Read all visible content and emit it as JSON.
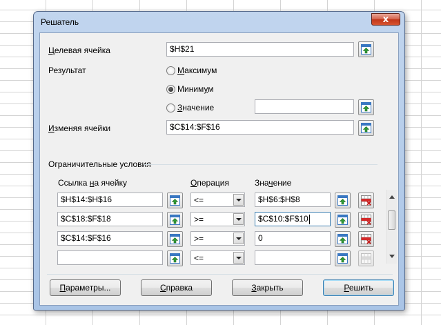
{
  "dialog": {
    "title": "Решатель",
    "close_glyph": "x",
    "target": {
      "label_ul": "Ц",
      "label_rest": "елевая ячейка",
      "value": "$H$21"
    },
    "result": {
      "label": "Результат",
      "options": [
        {
          "ul": "М",
          "rest": "аксимум",
          "checked": false
        },
        {
          "pre": "Миним",
          "ul": "у",
          "post": "м",
          "checked": true
        },
        {
          "ul": "З",
          "rest": "начение",
          "checked": false
        }
      ],
      "value_field": ""
    },
    "changing": {
      "label_ul": "И",
      "label_rest": "зменяя ячейки",
      "value": "$C$14:$F$16"
    },
    "constraints": {
      "group_label": "Ограничительные условия",
      "headers": {
        "cell_pre": "Ссылка ",
        "cell_ul": "н",
        "cell_post": "а ячейку",
        "op_ul": "О",
        "op_rest": "перация",
        "val_pre": "Зна",
        "val_ul": "ч",
        "val_post": "ение"
      },
      "rows": [
        {
          "cell": "$H$14:$H$16",
          "op": "<=",
          "value": "$H$6:$H$8"
        },
        {
          "cell": "$C$18:$F$18",
          "op": ">=",
          "value": "$C$10:$F$10"
        },
        {
          "cell": "$C$14:$F$16",
          "op": ">=",
          "value": "0"
        },
        {
          "cell": "",
          "op": "<=",
          "value": ""
        }
      ]
    },
    "buttons": {
      "params_ul": "П",
      "params_rest": "араметры...",
      "help_ul": "С",
      "help_rest": "правка",
      "close_ul": "З",
      "close_rest": "акрыть",
      "solve_ul": "Р",
      "solve_rest": "ешить"
    }
  },
  "icons": {
    "shrink": "shrink-icon",
    "remove": "remove-constraint-icon"
  },
  "colors": {
    "title_bar": "#b9d1ea",
    "close_button": "#c7432b",
    "delete_red": "#d42a2a"
  }
}
